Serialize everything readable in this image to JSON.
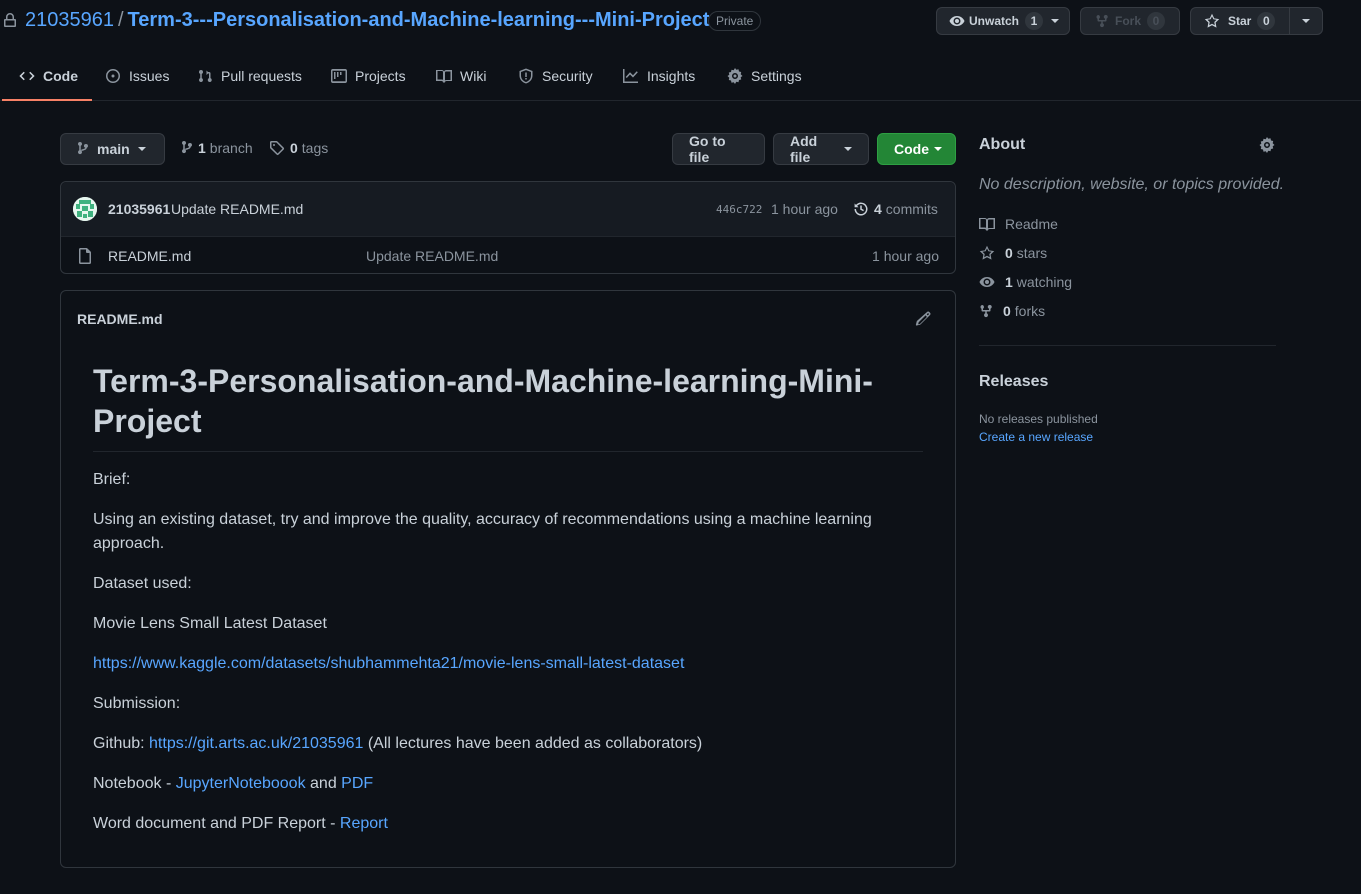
{
  "repo": {
    "owner": "21035961",
    "separator": "/",
    "name": "Term-3---Personalisation-and-Machine-learning---Mini-Project",
    "visibility": "Private"
  },
  "actions": {
    "unwatch_label": "Unwatch",
    "unwatch_count": "1",
    "fork_label": "Fork",
    "fork_count": "0",
    "star_label": "Star",
    "star_count": "0"
  },
  "tabs": [
    {
      "label": "Code",
      "icon": "code-icon",
      "active": true
    },
    {
      "label": "Issues",
      "icon": "issue-icon"
    },
    {
      "label": "Pull requests",
      "icon": "pull-request-icon"
    },
    {
      "label": "Projects",
      "icon": "project-icon"
    },
    {
      "label": "Wiki",
      "icon": "book-icon"
    },
    {
      "label": "Security",
      "icon": "shield-icon"
    },
    {
      "label": "Insights",
      "icon": "graph-icon"
    },
    {
      "label": "Settings",
      "icon": "gear-icon"
    }
  ],
  "branch_bar": {
    "branch": "main",
    "branch_count": "1",
    "branch_label": "branch",
    "tag_count": "0",
    "tag_label": "tags",
    "go_to_file": "Go to file",
    "add_file": "Add file",
    "code": "Code"
  },
  "latest_commit": {
    "author": "21035961",
    "message": "Update README.md",
    "sha": "446c722",
    "time": "1 hour ago",
    "commit_count": "4",
    "commit_label": "commits"
  },
  "files": [
    {
      "name": "README.md",
      "message": "Update README.md",
      "time": "1 hour ago",
      "icon": "file-icon"
    }
  ],
  "readme": {
    "filename": "README.md",
    "title": "Term-3-Personalisation-and-Machine-learning-Mini-Project",
    "brief_label": "Brief:",
    "brief_text": "Using an existing dataset, try and improve the quality, accuracy of recommendations using a machine learning approach.",
    "dataset_label": "Dataset used:",
    "dataset_name": "Movie Lens Small Latest Dataset",
    "dataset_url": "https://www.kaggle.com/datasets/shubhammehta21/movie-lens-small-latest-dataset",
    "submission_label": "Submission:",
    "github_prefix": "Github: ",
    "github_url": "https://git.arts.ac.uk/21035961",
    "github_suffix": " (All lectures have been added as collaborators)",
    "notebook_prefix": "Notebook - ",
    "notebook_link": "JupyterNoteboook",
    "notebook_and": " and ",
    "pdf_link": "PDF",
    "word_prefix": "Word document and PDF Report - ",
    "report_link": "Report"
  },
  "about": {
    "title": "About",
    "description": "No description, website, or topics provided.",
    "readme_label": "Readme",
    "stars_count": "0",
    "stars_label": "stars",
    "watching_count": "1",
    "watching_label": "watching",
    "forks_count": "0",
    "forks_label": "forks"
  },
  "releases": {
    "title": "Releases",
    "none_text": "No releases published",
    "create_link": "Create a new release"
  },
  "colors": {
    "background": "#0d1117",
    "link": "#58a6ff",
    "active_tab_underline": "#f78166",
    "primary_button": "#238636"
  }
}
